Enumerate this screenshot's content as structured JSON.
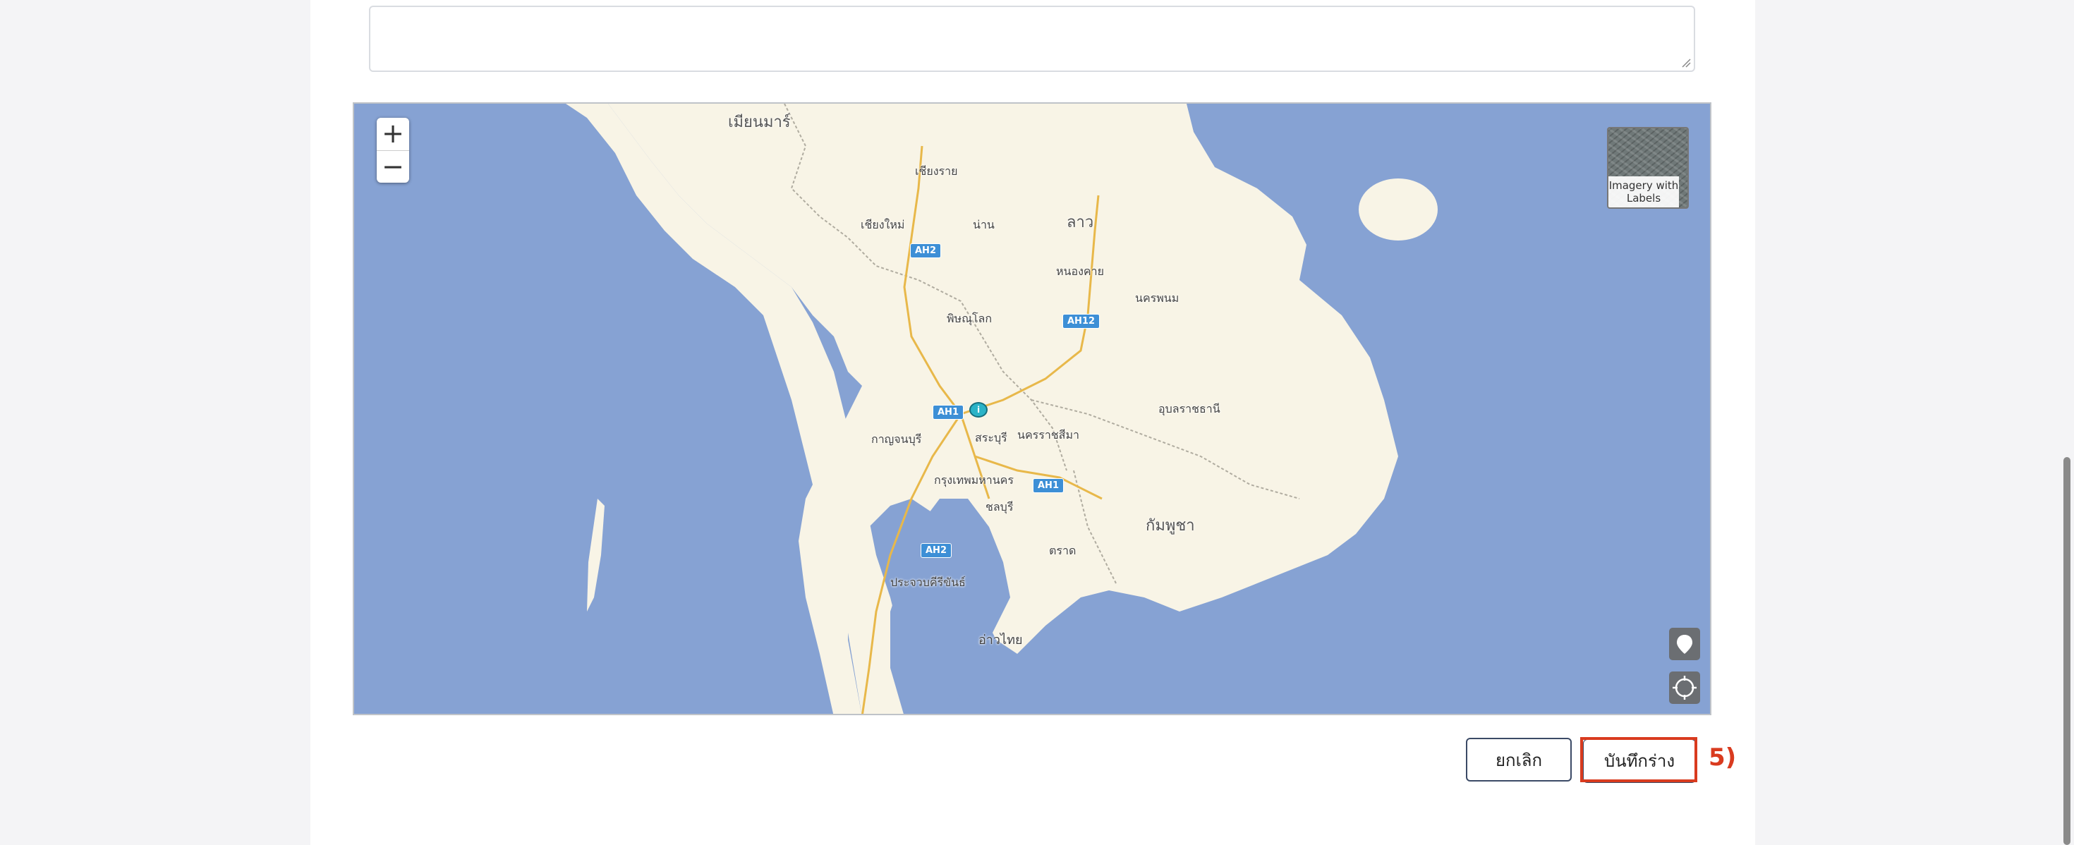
{
  "form": {
    "textarea_value": ""
  },
  "map": {
    "zoom_in": "+",
    "zoom_out": "−",
    "layer_toggle": "Imagery with Labels",
    "labels": {
      "myanmar": "เมียนมาร์",
      "laos": "ลาว",
      "cambodia": "กัมพูชา",
      "gulf": "อ่าวไทย",
      "chiangrai": "เชียงราย",
      "chiangmai": "เชียงใหม่",
      "nan": "น่าน",
      "nongkhai": "หนองคาย",
      "nakhonphanom": "นครพนม",
      "phitsanulok": "พิษณุโลก",
      "ubon": "อุบลราชธานี",
      "kanchanaburi": "กาญจนบุรี",
      "saraburi": "สระบุรี",
      "korat": "นครราชสีมา",
      "bangkok": "กรุงเทพมหานคร",
      "chonburi": "ชลบุรี",
      "trat": "ตราด",
      "prachuap": "ประจวบคีรีขันธ์"
    },
    "highways": {
      "ah2_north": "AH2",
      "ah12": "AH12",
      "ah1_center": "AH1",
      "ah1_east": "AH1",
      "ah2_south": "AH2"
    },
    "marker_glyph": "i",
    "icons": {
      "pin": "map-pin-icon",
      "locate": "locate-icon",
      "layers": "satellite-layer-icon"
    }
  },
  "actions": {
    "cancel_label": "ยกเลิก",
    "save_draft_label": "บันทึกร่าง",
    "step_annotation": "5)"
  },
  "colors": {
    "sea": "#86a2d3",
    "land": "#f8f4e6",
    "highlight": "#d93b1f",
    "road": "#e8b84a"
  }
}
